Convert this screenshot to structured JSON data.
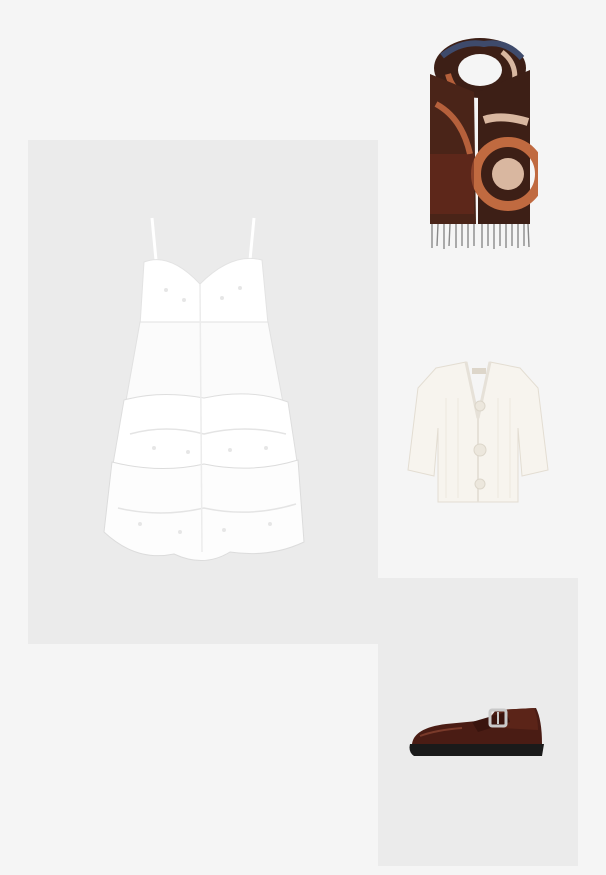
{
  "outfit": {
    "items": [
      {
        "icon": "dress-image",
        "colors": {
          "main": "#ffffff",
          "shade": "#e2e2e2"
        }
      },
      {
        "icon": "scarf-image",
        "colors": {
          "base": "#3d1f16",
          "accent": "#b5603b",
          "light": "#d9b7a0",
          "blue": "#3e4a6b"
        }
      },
      {
        "icon": "cardigan-image",
        "colors": {
          "main": "#f7f4ee",
          "shade": "#e6e1d8"
        }
      },
      {
        "icon": "shoe-image",
        "colors": {
          "leather": "#4a1c14",
          "sole": "#1a1a1a",
          "buckle": "#c9c9c9"
        }
      }
    ],
    "background_tiles": [
      "#ebebeb",
      "#ebebeb"
    ]
  }
}
